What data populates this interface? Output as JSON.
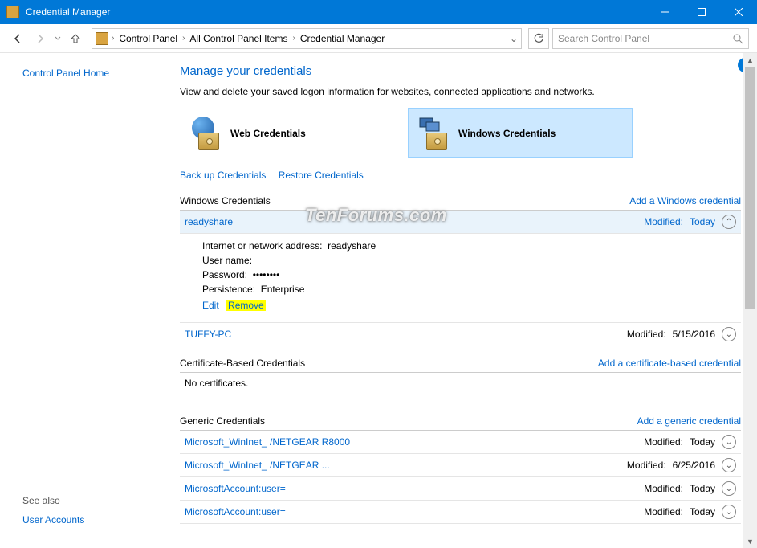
{
  "window": {
    "title": "Credential Manager"
  },
  "breadcrumb": {
    "cp": "Control Panel",
    "all": "All Control Panel Items",
    "cm": "Credential Manager"
  },
  "search": {
    "placeholder": "Search Control Panel"
  },
  "sidebar": {
    "home": "Control Panel Home",
    "see_also": "See also",
    "user_accounts": "User Accounts"
  },
  "page": {
    "title": "Manage your credentials",
    "subtitle": "View and delete your saved logon information for websites, connected applications and networks."
  },
  "types": {
    "web": "Web Credentials",
    "win": "Windows Credentials"
  },
  "actions": {
    "backup": "Back up Credentials",
    "restore": "Restore Credentials"
  },
  "sections": {
    "win": {
      "title": "Windows Credentials",
      "add": "Add a Windows credential"
    },
    "cert": {
      "title": "Certificate-Based Credentials",
      "add": "Add a certificate-based credential",
      "empty": "No certificates."
    },
    "gen": {
      "title": "Generic Credentials",
      "add": "Add a generic credential"
    }
  },
  "mod_label": "Modified:",
  "expanded": {
    "name": "readyshare",
    "modified": "Today",
    "addr_label": "Internet or network address:",
    "addr_value": "readyshare",
    "user_label": "User name:",
    "user_value": "",
    "pw_label": "Password:",
    "pw_value": "••••••••",
    "persist_label": "Persistence:",
    "persist_value": "Enterprise",
    "edit": "Edit",
    "remove": "Remove"
  },
  "win_rows": [
    {
      "name": "TUFFY-PC",
      "modified": "5/15/2016"
    }
  ],
  "gen_rows": [
    {
      "name": "Microsoft_WinInet_                       /NETGEAR R8000",
      "modified": "Today"
    },
    {
      "name": "Microsoft_WinInet_                                  /NETGEAR ...",
      "modified": "6/25/2016"
    },
    {
      "name": "MicrosoftAccount:user=",
      "modified": "Today"
    },
    {
      "name": "MicrosoftAccount:user=",
      "modified": "Today"
    }
  ],
  "watermark": "TenForums.com"
}
